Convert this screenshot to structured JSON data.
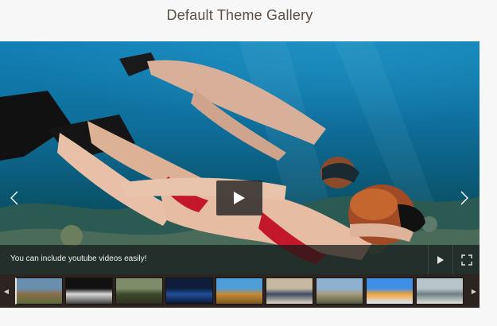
{
  "gallery": {
    "title": "Default Theme Gallery",
    "caption": "You can include youtube videos easily!",
    "icons": {
      "prev": "chevron-left-icon",
      "next": "chevron-right-icon",
      "play": "play-icon",
      "fullscreen": "fullscreen-icon"
    },
    "accent": "#e9e2d8"
  },
  "thumbnails": [
    {
      "name": "castle-landscape",
      "colors": [
        "#6a8fae",
        "#8a6e4a",
        "#5a6b3a"
      ]
    },
    {
      "name": "tiger",
      "colors": [
        "#111111",
        "#d9d9d9",
        "#444444"
      ]
    },
    {
      "name": "lake-trees",
      "colors": [
        "#7f8c6a",
        "#3d4a2c",
        "#2d3020"
      ]
    },
    {
      "name": "blue-creature",
      "colors": [
        "#0e1d3b",
        "#1f4f9c",
        "#0a1630"
      ]
    },
    {
      "name": "savanna",
      "colors": [
        "#4f9ed9",
        "#c78a36",
        "#7a5a23"
      ]
    },
    {
      "name": "two-people",
      "colors": [
        "#c7b8a0",
        "#3d4a63",
        "#e3d7c4"
      ]
    },
    {
      "name": "old-house",
      "colors": [
        "#8fb1d0",
        "#a89a7c",
        "#4e5b3a"
      ]
    },
    {
      "name": "sunglasses-face",
      "colors": [
        "#3f8fe6",
        "#f2a23a",
        "#d9e9fb"
      ]
    },
    {
      "name": "seashore",
      "colors": [
        "#b8c4c8",
        "#6e7e82",
        "#dfe3e0"
      ]
    }
  ]
}
